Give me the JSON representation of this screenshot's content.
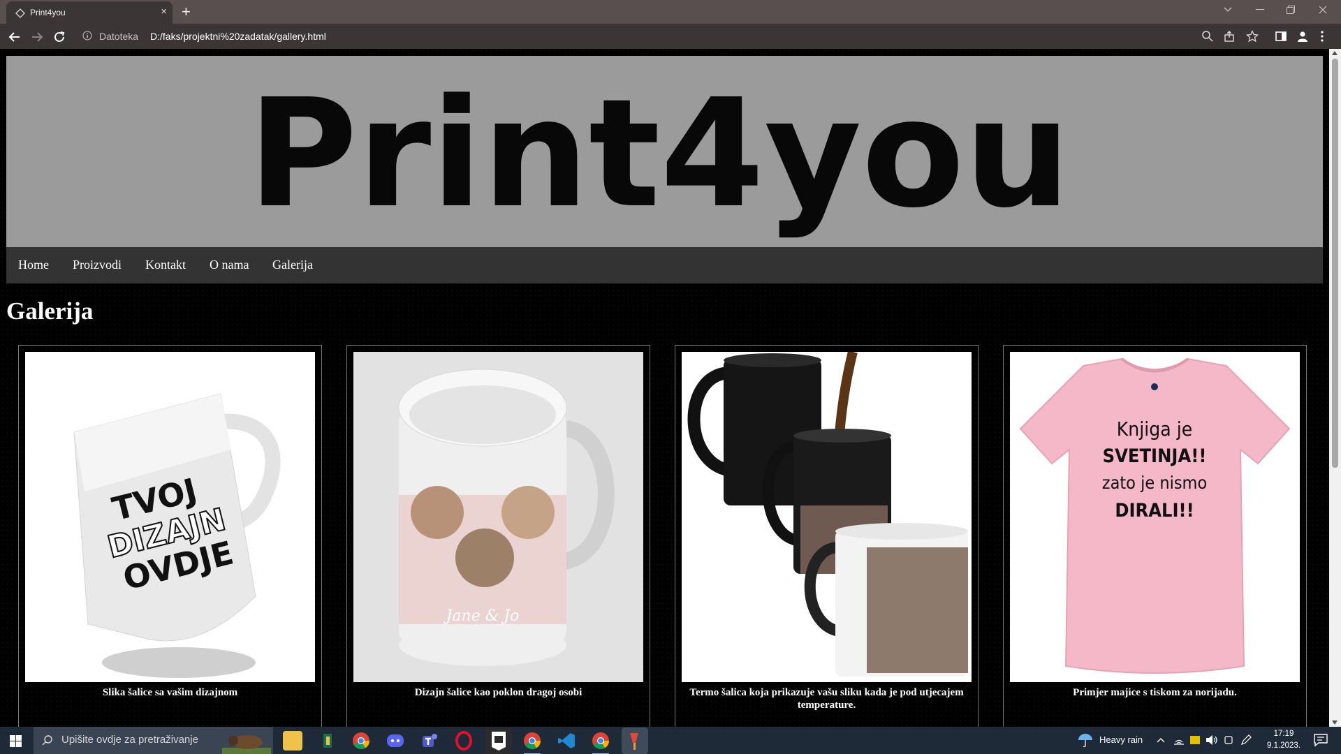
{
  "browser": {
    "tab_title": "Print4you",
    "new_tab_symbol": "+",
    "close_symbol": "×",
    "address_scheme": "Datoteka",
    "address_url": "D:/faks/projektni%20zadatak/gallery.html"
  },
  "page": {
    "logo": "Print4you",
    "nav": [
      "Home",
      "Proizvodi",
      "Kontakt",
      "O nama",
      "Galerija"
    ],
    "heading": "Galerija",
    "gallery": [
      {
        "caption": "Slika šalice sa vašim dizajnom",
        "mug_text": [
          "TVOJ",
          "DIZAJN",
          "OVDJE"
        ]
      },
      {
        "caption": "Dizajn šalice kao poklon dragoj osobi",
        "mug_script": "Jane & Jo"
      },
      {
        "caption": "Termo šalica koja prikazuje vašu sliku kada je pod utjecajem temperature."
      },
      {
        "caption": "Primjer majice s tiskom za norijadu.",
        "shirt_text": [
          "Knjiga je",
          "SVETINJA!!",
          "zato je nismo",
          "DIRALI!!"
        ]
      }
    ]
  },
  "taskbar": {
    "search_placeholder": "Upišite ovdje za pretraživanje",
    "weather": "Heavy rain",
    "time": "17:19",
    "date": "9.1.2023."
  },
  "colors": {
    "tabstrip": "#5a4f4f",
    "toolbar": "#3b3535",
    "banner": "#9b9b9b",
    "nav": "#333333",
    "page_bg": "#000000",
    "taskbar": "#1f2a38",
    "shirt": "#f5b8c8"
  }
}
